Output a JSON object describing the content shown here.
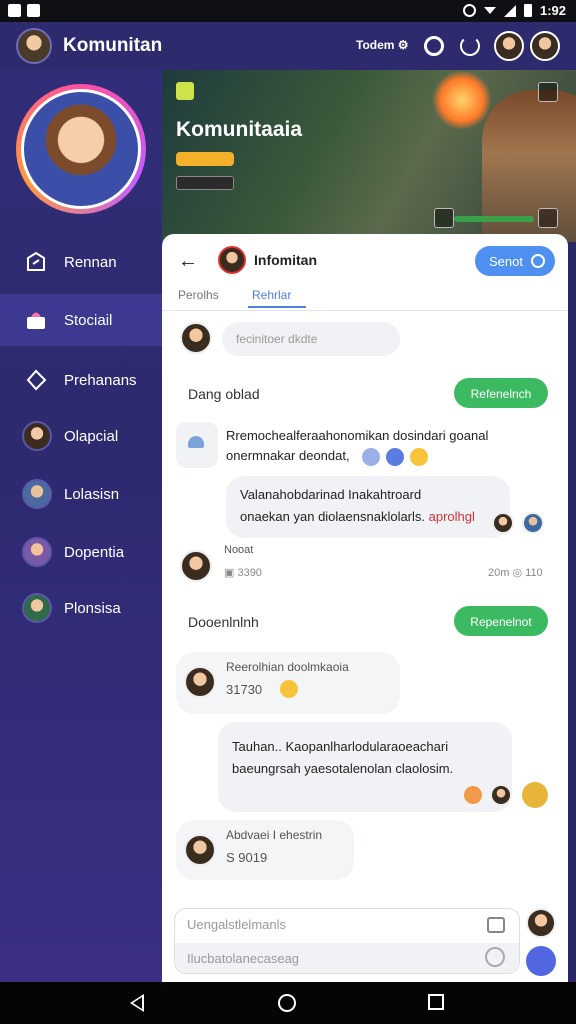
{
  "status": {
    "time": "1:92"
  },
  "header": {
    "title": "Komunitan",
    "link": "Todem"
  },
  "sidebar": {
    "items": [
      {
        "label": "Rennan",
        "icon": "edit-icon"
      },
      {
        "label": "Stociail",
        "icon": "shopping-bag-icon"
      },
      {
        "label": "Prehanans",
        "icon": "tag-icon"
      },
      {
        "label": "Olapcial"
      },
      {
        "label": "Lolasisn"
      },
      {
        "label": "Dopentia"
      },
      {
        "label": "Plonsisa"
      }
    ]
  },
  "banner": {
    "title": "Komunitaaia"
  },
  "panel": {
    "title": "Infomitan",
    "send_label": "Senot",
    "tabs": [
      "Perolhs",
      "Rehrlar"
    ],
    "composer_placeholder": "fecinitoer dkdte",
    "section1": {
      "label": "Dang oblad",
      "button": "Refenelnch"
    },
    "message1": {
      "line1": "Rremochealferaahonomikan dosindari goanal",
      "line2": "onermnakar deondat,"
    },
    "bubble1": {
      "line1": "Valanahobdarinad Inakahtroard",
      "line2": "onaekan yan diolaensnaklolarls.",
      "red": "aprolhgl"
    },
    "post": {
      "name": "Nooat",
      "count": "3390",
      "time": "20m",
      "time2": "110"
    },
    "section2": {
      "label": "Dooenlnlnh",
      "button": "Repenelnot"
    },
    "card1": {
      "name": "Reerolhian doolmkaoia",
      "number": "31730"
    },
    "bubble2": {
      "line1": "Tauhan.. Kaopanlharlodularaoeachari",
      "line2": "baeungrsah yaesotalenolan claolosim."
    },
    "card2": {
      "name": "Abdvaei I ehestrin",
      "number": "S 9019"
    },
    "input": {
      "row1": "Uengalstlelmanls",
      "row2": "Ilucbatolanecaseag"
    }
  }
}
